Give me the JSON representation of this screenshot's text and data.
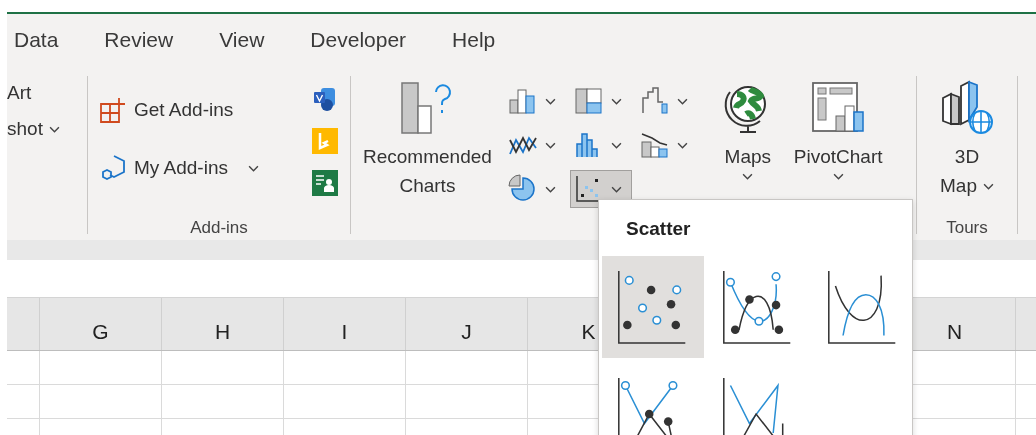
{
  "tabs": [
    {
      "label": "Data"
    },
    {
      "label": "Review"
    },
    {
      "label": "View"
    },
    {
      "label": "Developer"
    },
    {
      "label": "Help"
    }
  ],
  "illustrations": {
    "items": [
      {
        "label": "Art",
        "caret": false
      },
      {
        "label": "shot",
        "caret": true
      }
    ]
  },
  "addins": {
    "get": "Get Add-ins",
    "mine": "My Add-ins",
    "label": "Add-ins"
  },
  "charts": {
    "recommended": [
      "Recommended",
      "Charts"
    ],
    "buttons": [
      {
        "kind": "column",
        "selected": false
      },
      {
        "kind": "hierarchy",
        "selected": false
      },
      {
        "kind": "waterfall",
        "selected": false
      },
      {
        "kind": "line",
        "selected": false
      },
      {
        "kind": "statistic",
        "selected": false
      },
      {
        "kind": "combo",
        "selected": false
      },
      {
        "kind": "pie",
        "selected": false
      },
      {
        "kind": "scatter",
        "selected": true
      }
    ],
    "maps": "Maps",
    "pivot": "PivotChart"
  },
  "tours": {
    "map": [
      "3D",
      "Map"
    ],
    "label": "Tours"
  },
  "columns": {
    "left": [
      "G",
      "H",
      "I",
      "J",
      "K"
    ],
    "right": [
      "N"
    ]
  },
  "scatter_menu": {
    "title": "Scatter",
    "items": [
      {
        "kind": "markers",
        "selected": true
      },
      {
        "kind": "smooth-markers",
        "selected": false
      },
      {
        "kind": "smooth",
        "selected": false
      },
      {
        "kind": "straight-markers",
        "selected": false
      },
      {
        "kind": "straight",
        "selected": false
      }
    ]
  }
}
